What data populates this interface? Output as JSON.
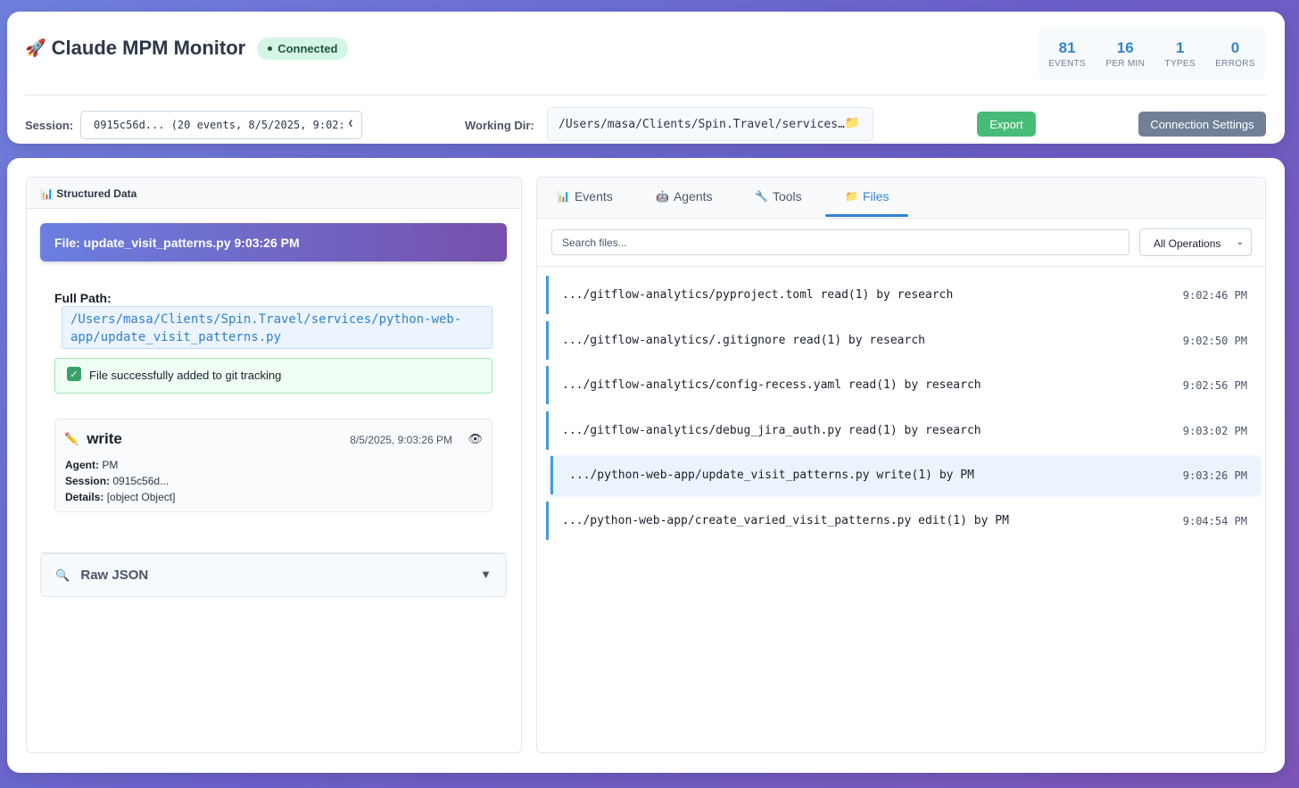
{
  "header": {
    "rocket_icon": "🚀",
    "title": "Claude MPM Monitor",
    "status": "Connected",
    "stats": [
      {
        "value": "81",
        "label": "EVENTS"
      },
      {
        "value": "16",
        "label": "PER MIN"
      },
      {
        "value": "1",
        "label": "TYPES"
      },
      {
        "value": "0",
        "label": "ERRORS"
      }
    ],
    "session_label": "Session:",
    "session_value": "0915c56d... (20 events, 8/5/2025, 9:02:",
    "working_dir_label": "Working Dir:",
    "working_dir_value": "/Users/masa/Clients/Spin.Travel/services…",
    "export_label": "Export",
    "connection_settings_label": "Connection Settings"
  },
  "left_panel": {
    "header_icon": "📊",
    "header_title": "Structured Data",
    "file_banner": "File: update_visit_patterns.py 9:03:26 PM",
    "full_path_label": "Full Path:",
    "full_path_line1": "/Users/masa/Clients/Spin.Travel/services/python-web-",
    "full_path_line2": "app/update_visit_patterns.py",
    "success_message": "File successfully added to git tracking",
    "operation": {
      "icon": "✏️",
      "name": "write",
      "timestamp": "8/5/2025, 9:03:26 PM",
      "agent_label": "Agent:",
      "agent_value": "PM",
      "session_label": "Session:",
      "session_value": "0915c56d...",
      "details_label": "Details:",
      "details_value": "[object Object]"
    },
    "raw_json_label": "Raw JSON"
  },
  "right_panel": {
    "tabs": [
      {
        "icon": "📊",
        "label": "Events"
      },
      {
        "icon": "🤖",
        "label": "Agents"
      },
      {
        "icon": "🔧",
        "label": "Tools"
      },
      {
        "icon": "📁",
        "label": "Files"
      }
    ],
    "active_tab": "Files",
    "search_placeholder": "Search files...",
    "operations_filter": "All Operations",
    "files": [
      {
        "text": ".../gitflow-analytics/pyproject.toml read(1) by research",
        "time": "9:02:46 PM"
      },
      {
        "text": ".../gitflow-analytics/.gitignore read(1) by research",
        "time": "9:02:50 PM"
      },
      {
        "text": ".../gitflow-analytics/config-recess.yaml read(1) by research",
        "time": "9:02:56 PM"
      },
      {
        "text": ".../gitflow-analytics/debug_jira_auth.py read(1) by research",
        "time": "9:03:02 PM"
      },
      {
        "text": ".../python-web-app/update_visit_patterns.py write(1) by PM",
        "time": "9:03:26 PM"
      },
      {
        "text": ".../python-web-app/create_varied_visit_patterns.py edit(1) by PM",
        "time": "9:04:54 PM"
      }
    ]
  }
}
